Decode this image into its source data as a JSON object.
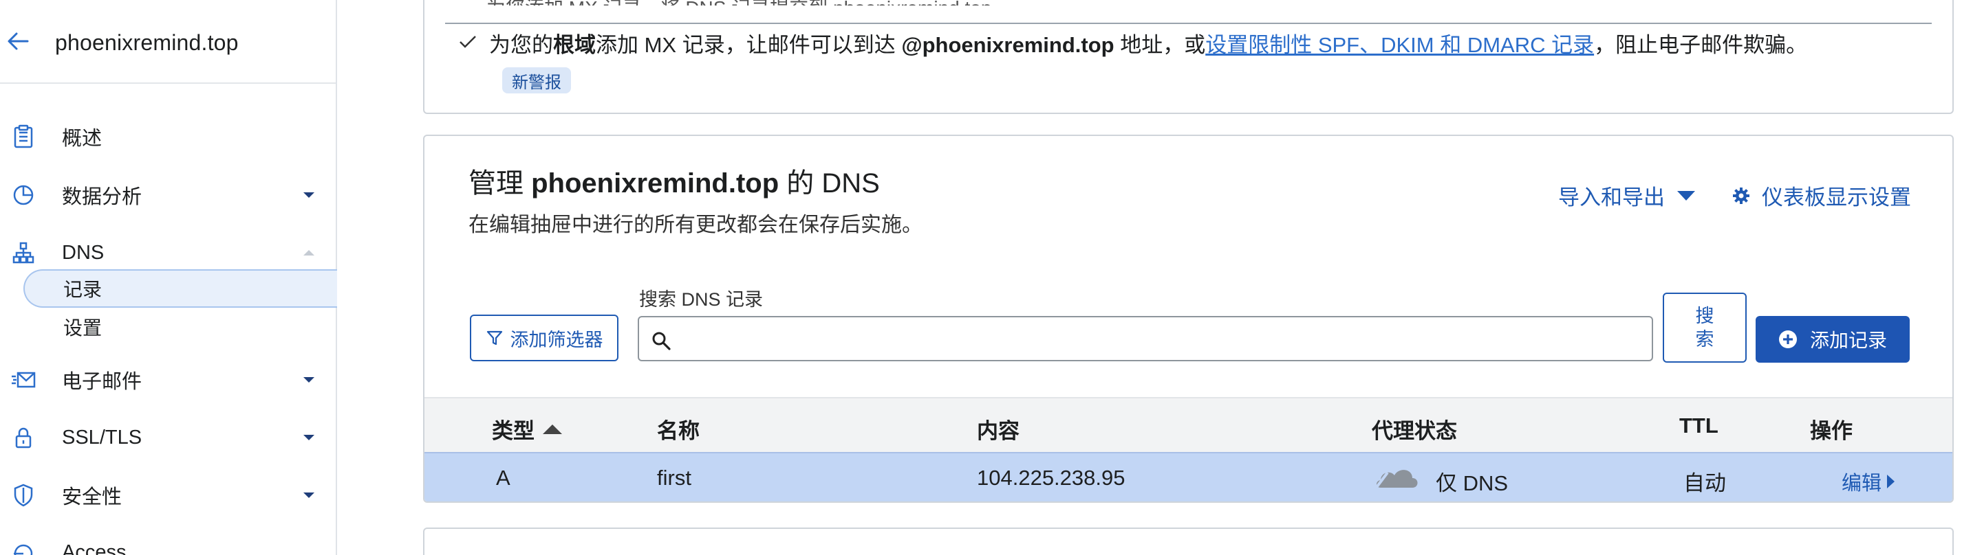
{
  "sidebar": {
    "site_name": "phoenixremind.top",
    "items": [
      {
        "label": "概述"
      },
      {
        "label": "数据分析"
      },
      {
        "label": "DNS"
      },
      {
        "label": "电子邮件"
      },
      {
        "label": "SSL/TLS"
      },
      {
        "label": "安全性"
      },
      {
        "label": "Access"
      }
    ],
    "dns_sub": [
      {
        "label": "记录"
      },
      {
        "label": "设置"
      }
    ]
  },
  "alert": {
    "cut_text": "为您添加 MX 记录，将 DNS 记录提交到 phoenixremind.top。",
    "text_prefix": "为您的",
    "text_bold1": "根域",
    "text_mid": "添加 MX 记录，让邮件可以到达 ",
    "text_bold2": "@phoenixremind.top",
    "text_mid2": " 地址，或",
    "link": "设置限制性 SPF、DKIM 和 DMARC 记录",
    "text_end": "，阻止电子邮件欺骗。",
    "badge": "新警报"
  },
  "dns": {
    "title_prefix": "管理 ",
    "title_domain": "phoenixremind.top",
    "title_suffix": " 的 DNS",
    "subtitle": "在编辑抽屉中进行的所有更改都会在保存后实施。",
    "import_export": "导入和导出",
    "dashboard_settings": "仪表板显示设置",
    "filter_button": "添加筛选器",
    "search_label": "搜索 DNS 记录",
    "search_value": "",
    "search_button": "搜索",
    "add_record_button": "添加记录",
    "columns": [
      "类型",
      "名称",
      "内容",
      "代理状态",
      "TTL",
      "操作"
    ],
    "rows": [
      {
        "type": "A",
        "name": "first",
        "content": "104.225.238.95",
        "proxy": "仅 DNS",
        "ttl": "自动",
        "action": "编辑"
      }
    ]
  },
  "colors": {
    "accent": "#1f5ab3",
    "row_highlight": "#c2d6f5",
    "link": "#2c6ecb"
  },
  "icons": {
    "back": "arrow-left-icon",
    "overview": "clipboard-icon",
    "analytics": "pie-chart-icon",
    "dns": "network-icon",
    "email": "email-icon",
    "ssl": "lock-icon",
    "security": "shield-icon",
    "access": "access-icon",
    "settings": "gear-icon",
    "filter": "filter-icon",
    "search": "search-icon",
    "add": "plus-circle-icon",
    "proxy": "cloud-icon"
  }
}
